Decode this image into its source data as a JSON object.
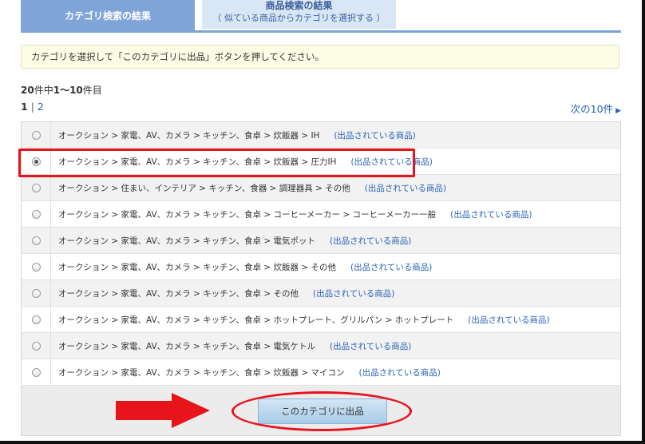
{
  "tabs": {
    "active_label": "カテゴリ検索の結果",
    "inactive_title": "商品検索の結果",
    "inactive_sub": "（ 似ている商品からカテゴリを選択する ）"
  },
  "notice": "カテゴリを選択して「このカテゴリに出品」ボタンを押してください。",
  "count": {
    "total": "20",
    "mid1": "件中",
    "range": "1～10",
    "suffix": "件目"
  },
  "pager": {
    "current": "1",
    "separator": "|",
    "page2": "2",
    "next_label": "次の10件"
  },
  "rows": [
    {
      "path": "オークション > 家電、AV、カメラ > キッチン、食卓 > 炊飯器 > IH",
      "link": "(出品されている商品)",
      "checked": false
    },
    {
      "path": "オークション > 家電、AV、カメラ > キッチン、食卓 > 炊飯器 > 圧力IH",
      "link": "(出品されている商品)",
      "checked": true
    },
    {
      "path": "オークション > 住まい、インテリア > キッチン、食器 > 調理器具 > その他",
      "link": "(出品されている商品)",
      "checked": false
    },
    {
      "path": "オークション > 家電、AV、カメラ > キッチン、食卓 > コーヒーメーカー > コーヒーメーカー一般",
      "link": "(出品されている商品)",
      "checked": false
    },
    {
      "path": "オークション > 家電、AV、カメラ > キッチン、食卓 > 電気ポット",
      "link": "(出品されている商品)",
      "checked": false
    },
    {
      "path": "オークション > 家電、AV、カメラ > キッチン、食卓 > 炊飯器 > その他",
      "link": "(出品されている商品)",
      "checked": false
    },
    {
      "path": "オークション > 家電、AV、カメラ > キッチン、食卓 > その他",
      "link": "(出品されている商品)",
      "checked": false
    },
    {
      "path": "オークション > 家電、AV、カメラ > キッチン、食卓 > ホットプレート、グリルパン > ホットプレート",
      "link": "(出品されている商品)",
      "checked": false
    },
    {
      "path": "オークション > 家電、AV、カメラ > キッチン、食卓 > 電気ケトル",
      "link": "(出品されている商品)",
      "checked": false
    },
    {
      "path": "オークション > 家電、AV、カメラ > キッチン、食卓 > 炊飯器 > マイコン",
      "link": "(出品されている商品)",
      "checked": false
    }
  ],
  "submit_label": "このカテゴリに出品",
  "colors": {
    "accent": "#7fa5d8",
    "link": "#2a62b8",
    "annotation_red": "#e8141b"
  },
  "icons": {
    "next": "triangle-right-icon",
    "annotation_arrow": "right-arrow-icon"
  }
}
